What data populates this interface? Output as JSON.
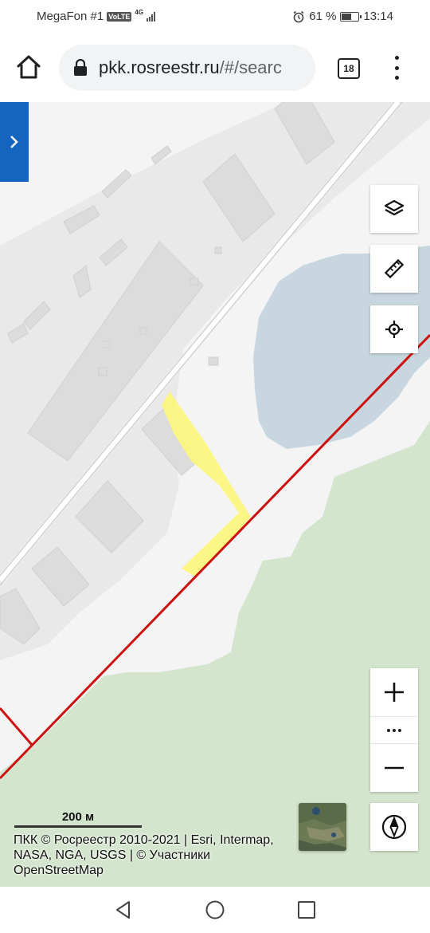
{
  "status_bar": {
    "carrier": "MegaFon #1",
    "volte": "VoLTE",
    "network": "4G",
    "battery_percent": "61 %",
    "battery_level": 0.61,
    "time": "13:14"
  },
  "browser": {
    "url_host": "pkk.rosreestr.ru",
    "url_rest": "/#/searc",
    "tab_count": "18"
  },
  "map": {
    "scale_label": "200 м",
    "attribution": "ПКК © Росреестр 2010-2021 | Esri, Intermap, NASA, NGA, USGS | © Участники OpenStreetMap",
    "colors": {
      "water": "#c7d6df",
      "forest": "#d3e5cc",
      "highlight": "#fbf680",
      "boundary": "#cc1111",
      "building": "#e0e0e0"
    }
  },
  "icons": {
    "home": "home-icon",
    "lock": "lock-icon",
    "layers": "layers-icon",
    "ruler": "ruler-icon",
    "locate": "crosshair-icon",
    "zoom_in": "plus-icon",
    "zoom_out": "minus-icon",
    "compass": "compass-icon",
    "side_panel": "chevron-right-icon"
  }
}
